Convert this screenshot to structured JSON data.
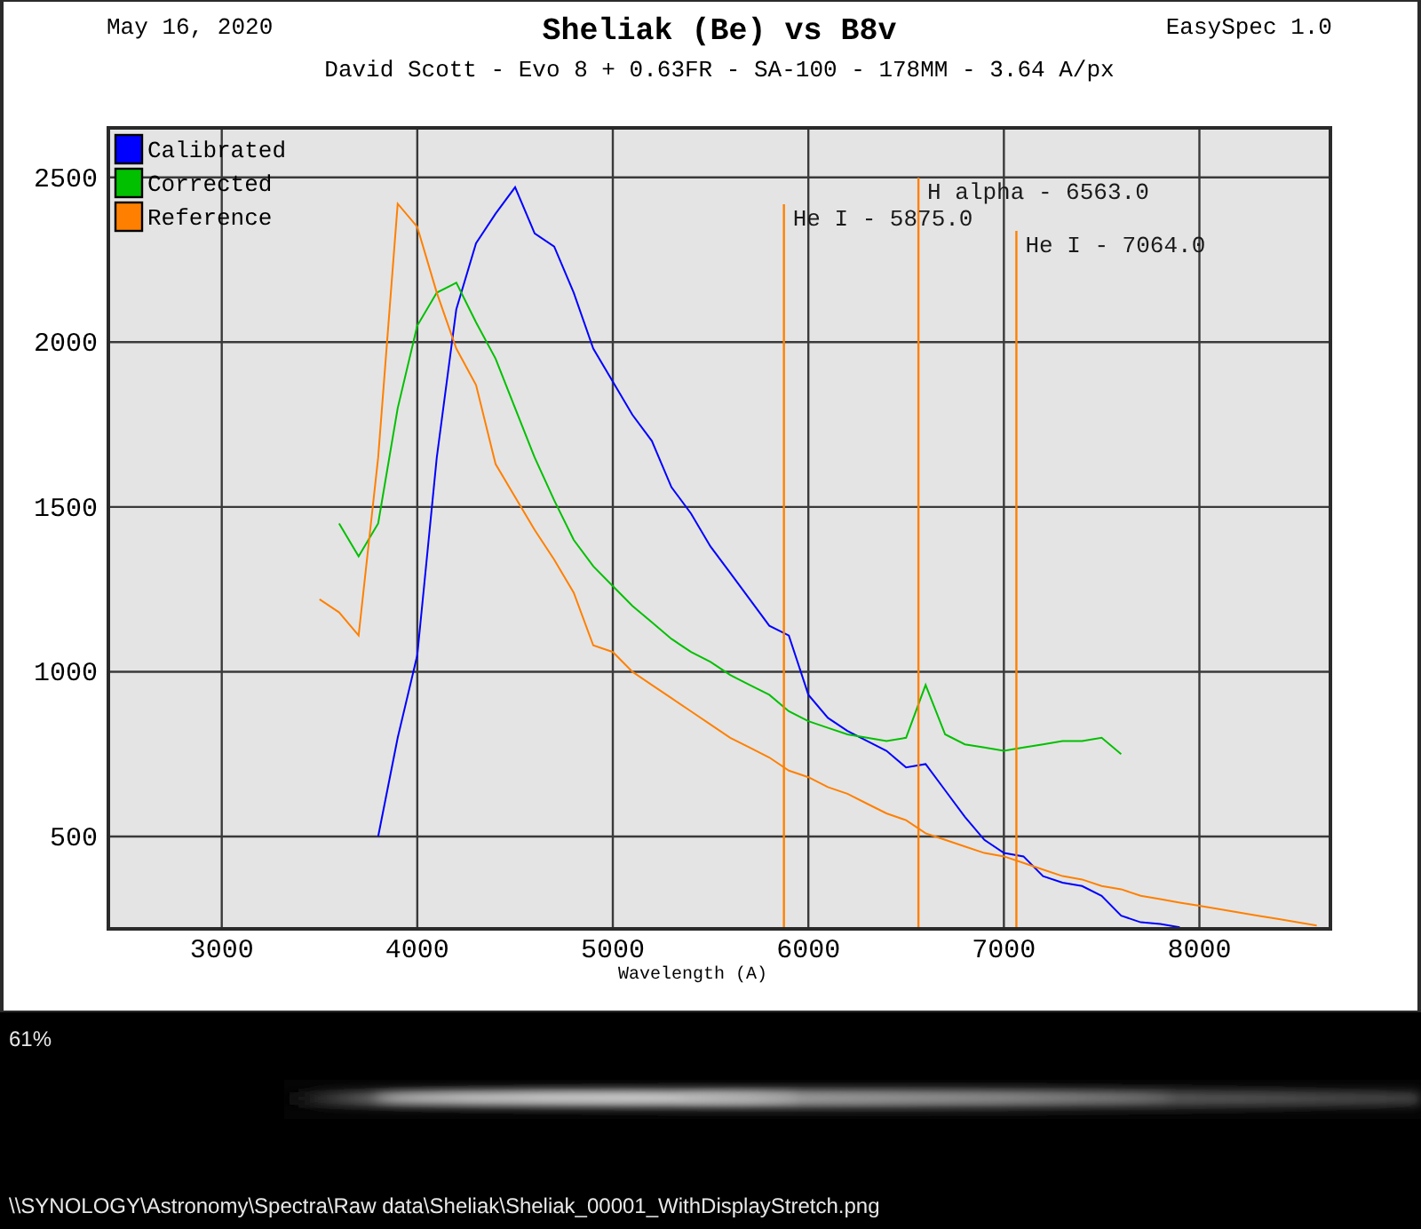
{
  "header": {
    "date": "May 16, 2020",
    "title": "Sheliak (Be) vs B8v",
    "subtitle": "David Scott - Evo 8 + 0.63FR - SA-100 - 178MM - 3.64 A/px",
    "app": "EasySpec 1.0"
  },
  "chart": {
    "chart_data": {
      "type": "line",
      "xlabel": "Wavelength (A)",
      "xlim": [
        2420,
        8670
      ],
      "ylim": [
        220,
        2650
      ],
      "xticks": [
        3000,
        4000,
        5000,
        6000,
        7000,
        8000
      ],
      "yticks": [
        500,
        1000,
        1500,
        2000,
        2500
      ],
      "x": [
        3500,
        3600,
        3700,
        3800,
        3900,
        4000,
        4100,
        4200,
        4300,
        4400,
        4500,
        4600,
        4700,
        4800,
        4900,
        5000,
        5100,
        5200,
        5300,
        5400,
        5500,
        5600,
        5700,
        5800,
        5900,
        6000,
        6100,
        6200,
        6300,
        6400,
        6500,
        6600,
        6700,
        6800,
        6900,
        7000,
        7100,
        7200,
        7300,
        7400,
        7500,
        7600,
        7700,
        7800,
        7900,
        8000,
        8100,
        8200,
        8300,
        8400,
        8500,
        8600
      ],
      "series": [
        {
          "name": "Calibrated",
          "color": "#0000ff",
          "values": [
            null,
            null,
            null,
            500,
            800,
            1050,
            1650,
            2100,
            2300,
            2390,
            2470,
            2330,
            2290,
            2150,
            1980,
            1880,
            1780,
            1700,
            1560,
            1480,
            1380,
            1300,
            1220,
            1140,
            1110,
            930,
            860,
            820,
            790,
            760,
            710,
            720,
            640,
            560,
            490,
            450,
            440,
            380,
            360,
            350,
            320,
            260,
            240,
            235,
            225,
            null,
            null,
            null,
            null,
            null,
            null,
            null
          ]
        },
        {
          "name": "Corrected",
          "color": "#00c000",
          "values": [
            null,
            1450,
            1350,
            1450,
            1800,
            2050,
            2150,
            2180,
            2060,
            1950,
            1800,
            1650,
            1520,
            1400,
            1320,
            1260,
            1200,
            1150,
            1100,
            1060,
            1030,
            990,
            960,
            930,
            880,
            850,
            830,
            810,
            800,
            790,
            800,
            960,
            810,
            780,
            770,
            760,
            770,
            780,
            790,
            790,
            800,
            750,
            null,
            null,
            null,
            null,
            null,
            null,
            null,
            null,
            null,
            null
          ]
        },
        {
          "name": "Reference",
          "color": "#ff8000",
          "values": [
            1220,
            1180,
            1110,
            1650,
            2420,
            2350,
            2150,
            1980,
            1870,
            1630,
            1530,
            1430,
            1340,
            1240,
            1080,
            1060,
            1000,
            960,
            920,
            880,
            840,
            800,
            770,
            740,
            700,
            680,
            650,
            630,
            600,
            570,
            550,
            510,
            490,
            470,
            450,
            440,
            420,
            400,
            380,
            370,
            350,
            340,
            320,
            310,
            300,
            290,
            280,
            270,
            260,
            250,
            240,
            230
          ]
        }
      ],
      "grid": true,
      "legend": "upper left",
      "ref_lines": [
        {
          "axis": "x",
          "value": 5875,
          "label": "He I - 5875.0"
        },
        {
          "axis": "x",
          "value": 6563,
          "label": "H alpha - 6563.0"
        },
        {
          "axis": "x",
          "value": 7064,
          "label": "He I - 7064.0"
        }
      ]
    }
  },
  "viewer": {
    "zoom": "61%",
    "file_path": "\\\\SYNOLOGY\\Astronomy\\Spectra\\Raw data\\Sheliak\\Sheliak_00001_WithDisplayStretch.png"
  }
}
